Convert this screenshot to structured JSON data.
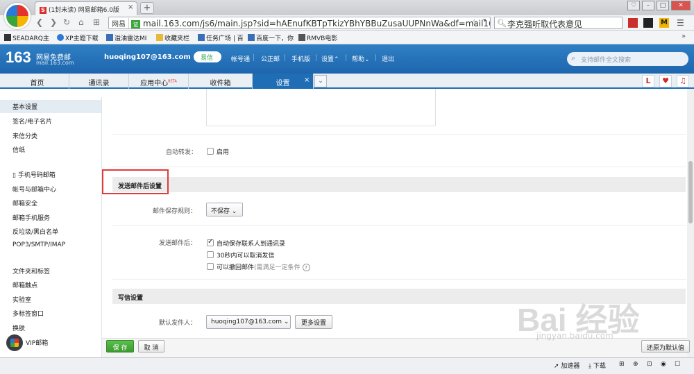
{
  "browser": {
    "tab_title": "(1封未读) 网易邮箱6.0版",
    "tab_close": "×",
    "new_tab": "+",
    "url_site": "网易",
    "url_shield": "证",
    "url": "mail.163.com/js6/main.jsp?sid=hAEnufKBTpTkizYBhYBBuZusaUUPNnWa&df=mail163",
    "search_text": "李克强听取代表意见",
    "bookmarks": [
      "SEADARQ主",
      "XP主题下载",
      "溢油雷达MI",
      "收藏夹栏",
      "任务广场 | 百",
      "百度一下，你",
      "RMVB电影"
    ]
  },
  "header": {
    "logo_num": "163",
    "logo_title": "网易免费邮",
    "logo_domain": "mail.163.com",
    "account": "huoqing107@163.com",
    "yixin": "易信",
    "links": [
      "帐号通",
      "公正邮",
      "手机版",
      "设置⌃",
      "帮助⌄",
      "退出"
    ],
    "search_placeholder": "支持邮件全文搜索"
  },
  "tabs": {
    "items": [
      "首页",
      "通讯录",
      "应用中心",
      "收件箱",
      "设置"
    ],
    "beta": "BETA",
    "close": "×",
    "dropdown": "⌄",
    "icons": [
      "L",
      "♥",
      "♫"
    ]
  },
  "sidebar": {
    "group1": [
      "基本设置",
      "签名/电子名片",
      "来信分类",
      "信纸"
    ],
    "group2": [
      "▯ 手机号码邮箱",
      "帐号与邮箱中心",
      "邮箱安全",
      "邮箱手机服务",
      "反垃圾/黑白名单",
      "POP3/SMTP/IMAP"
    ],
    "group3": [
      "文件夹和标签",
      "邮箱触点",
      "实验室",
      "多标签窗口",
      "换肤",
      "VIP邮箱"
    ]
  },
  "settings": {
    "auto_forward_label": "自动转发：",
    "auto_forward_option": "启用",
    "send_section_title": "发送邮件后设置",
    "save_rule_label": "邮件保存规则：",
    "save_rule_value": "不保存",
    "after_send_label": "发送邮件后：",
    "after_send_options": [
      {
        "text": "自动保存联系人到通讯录",
        "checked": true
      },
      {
        "text": "30秒内可以取消发信",
        "checked": false
      },
      {
        "text": "可以撤回邮件",
        "note": "(需满足一定条件",
        "checked": false
      }
    ],
    "help": "?",
    "compose_section_title": "写信设置",
    "default_sender_label": "默认发件人：",
    "default_sender_value": "huoqing107@163.com",
    "more_settings": "更多设置"
  },
  "footer": {
    "save": "保 存",
    "cancel": "取 消",
    "restore": "还原为默认值"
  },
  "statusbar": {
    "accelerator": "加速器",
    "download": "下载"
  },
  "watermark": {
    "brand": "Bai 经验",
    "url": "jingyan.baidu.com"
  }
}
